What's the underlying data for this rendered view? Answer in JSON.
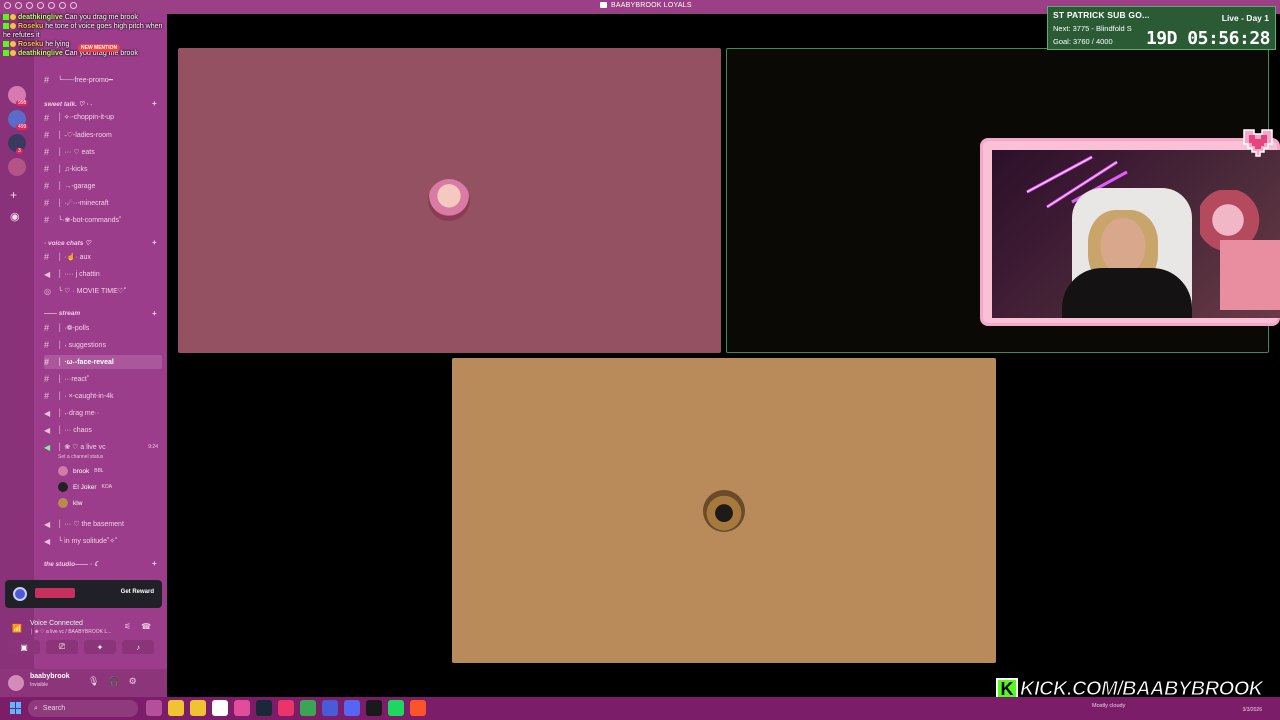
{
  "window": {
    "title": "BAABYBROOK LOYALS"
  },
  "chat": [
    {
      "user": "deathkinglive",
      "text": "Can you drag me brook",
      "style": "u1"
    },
    {
      "user": "Roseku",
      "text": "he tone of voice goes high pitch when",
      "style": "u2"
    },
    {
      "user": "",
      "text": "he refutes it",
      "style": "u2"
    },
    {
      "user": "Roseku",
      "text": "he lying",
      "style": "u2"
    },
    {
      "user": "deathkinglive",
      "text": "Can you drag me brook",
      "style": "u1"
    }
  ],
  "new_mention": "NEW MENTION",
  "sidebar": {
    "guild_badges": [
      "998",
      "499",
      "3"
    ],
    "categories": {
      "sweet_talk": "sweet talk. ♡ · ˖",
      "voice_chats": "· voice chats ♡",
      "stream": "—— stream",
      "studio": "the studio—— · ☾"
    },
    "channels": {
      "free_promo": "╰──-free-promo━",
      "choppin": "│ ⟡·-choppin-it-up",
      "ladies": "│ ˗♡-ladies-room",
      "eats": "│ ··· ♡ eats",
      "kicks": "│ ♫-kicks",
      "garage": "│ →-garage",
      "minecraft": "│ ·☄··-minecraft",
      "bot": "╰·❀-bot-commands˚",
      "aux": "│ ·☝· aux",
      "chattin": "│ ···· j chattin",
      "movie": "╰ ♡ · MOVIE TIME♡˚",
      "polls": "│ ·❁-polls",
      "suggestions": "│ ˖ suggestions",
      "face_reveal": "│ ·ω˖-face-reveal",
      "react": "│ ···react˚",
      "caught": "│ · ×-caught-in-4k",
      "drag_me": "│ ˖·drag me··",
      "chaos": "│ ··· chaos",
      "live_vc": "│ ❀ ♡ a live vc",
      "basement": "│ ··· ♡ the basement",
      "solitude": "╰ in my solitude˚✧˚"
    },
    "live_vc_time": "9:24",
    "status_hint": "Set a channel status",
    "vc_users": [
      {
        "name": "brook",
        "tag": "BBL"
      },
      {
        "name": "El Joker",
        "tag": "KOA"
      },
      {
        "name": "klw",
        "tag": ""
      }
    ],
    "reward": {
      "button": "Get Reward"
    },
    "voice": {
      "status": "Voice Connected",
      "location": "│ ❀ ♡ a live vc / BAABYBROOK L..."
    },
    "user": {
      "name": "baabybrook",
      "status": "Invisible"
    }
  },
  "subgoal": {
    "title": "ST PATRICK SUB GO...",
    "day": "Live - Day 1",
    "next": "Next: 3775 - Blindfold S",
    "goal": "Goal: 3760 / 4000",
    "timer": "19D 05:56:28"
  },
  "kick": {
    "letter": "K",
    "url": "KICK.COM/BAABYBROOK"
  },
  "taskbar": {
    "search_placeholder": "Search",
    "weather": "Mostly cloudy",
    "date": "3/3/2026"
  },
  "colors": {
    "sidebar": "#9c3d8b",
    "tile_pink": "#935161",
    "tile_tan": "#b98b5b",
    "kick_green": "#53fc18",
    "goal_green": "#2a5b34"
  }
}
